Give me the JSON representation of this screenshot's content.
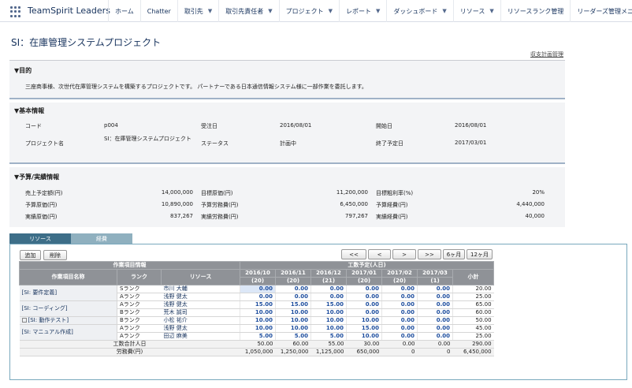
{
  "app": {
    "name": "TeamSpirit Leaders"
  },
  "nav": [
    {
      "label": "ホーム",
      "chevron": false
    },
    {
      "label": "Chatter",
      "chevron": false
    },
    {
      "label": "取引先",
      "chevron": true
    },
    {
      "label": "取引先責任者",
      "chevron": true
    },
    {
      "label": "プロジェクト",
      "chevron": true
    },
    {
      "label": "レポート",
      "chevron": true
    },
    {
      "label": "ダッシュボード",
      "chevron": true
    },
    {
      "label": "リソース",
      "chevron": true
    },
    {
      "label": "リソースランク管理",
      "chevron": false
    },
    {
      "label": "リーダーズ管理メニュー",
      "chevron": false
    }
  ],
  "page": {
    "title": "SI：在庫管理システムプロジェクト",
    "top_link": "収支計画管理"
  },
  "purpose": {
    "header": "▼目的",
    "text": "三座商事様、次世代在庫管理システムを構築するプロジェクトです。 パートナーである日本通信情報システム様に一部作業を委託します。"
  },
  "basic": {
    "header": "▼基本情報",
    "code_label": "コード",
    "code_value": "p004",
    "order_label": "受注日",
    "order_value": "2016/08/01",
    "start_label": "開始日",
    "start_value": "2016/08/01",
    "name_label": "プロジェクト名",
    "name_value": "SI：在庫管理システムプロジェクト",
    "status_label": "ステータス",
    "status_value": "計画中",
    "end_label": "終了予定日",
    "end_value": "2017/03/01"
  },
  "budget": {
    "header": "▼予算/実績情報",
    "sales_label": "売上予定額(円)",
    "sales_value": "14,000,000",
    "target_cost_label": "目標原価(円)",
    "target_cost_value": "11,200,000",
    "target_margin_label": "目標粗利率(%)",
    "target_margin_value": "20%",
    "budget_cost_label": "予算原価(円)",
    "budget_cost_value": "10,890,000",
    "budget_labor_label": "予算労務費(円)",
    "budget_labor_value": "6,450,000",
    "budget_exp_label": "予算経費(円)",
    "budget_exp_value": "4,440,000",
    "actual_cost_label": "実績原価(円)",
    "actual_cost_value": "837,267",
    "actual_labor_label": "実績労務費(円)",
    "actual_labor_value": "797,267",
    "actual_exp_label": "実績経費(円)",
    "actual_exp_value": "40,000"
  },
  "tabs": {
    "resource": "リソース",
    "expense": "経費"
  },
  "toolbar": {
    "add": "追加",
    "delete": "削除",
    "first": "<<",
    "prev": "<",
    "next": ">",
    "last": ">>",
    "six": "6ヶ月",
    "twelve": "12ヶ月"
  },
  "table": {
    "group_header": "作業項目情報",
    "plan_header": "工数予定(人日)",
    "col_item": "作業項目名称",
    "col_rank": "ランク",
    "col_resource": "リソース",
    "col_subtotal": "小計",
    "months": [
      {
        "label": "2016/10",
        "days": "(20)"
      },
      {
        "label": "2016/11",
        "days": "(20)"
      },
      {
        "label": "2016/12",
        "days": "(21)"
      },
      {
        "label": "2017/01",
        "days": "(20)"
      },
      {
        "label": "2017/02",
        "days": "(20)"
      },
      {
        "label": "2017/03",
        "days": "(1)"
      }
    ],
    "groups": [
      {
        "name": "[SI: 要件定義]",
        "checkbox": false,
        "rows": [
          {
            "rank": "Sランク",
            "resource": "市川 大輔",
            "values": [
              "0.00",
              "0.00",
              "0.00",
              "0.00",
              "0.00",
              "0.00"
            ],
            "subtotal": "20.00"
          },
          {
            "rank": "Aランク",
            "resource": "浅野 健太",
            "values": [
              "0.00",
              "0.00",
              "0.00",
              "0.00",
              "0.00",
              "0.00"
            ],
            "subtotal": "25.00"
          }
        ]
      },
      {
        "name": "[SI: コーディング]",
        "checkbox": false,
        "rows": [
          {
            "rank": "Aランク",
            "resource": "浅野 健太",
            "values": [
              "15.00",
              "15.00",
              "15.00",
              "0.00",
              "0.00",
              "0.00"
            ],
            "subtotal": "65.00"
          },
          {
            "rank": "Bランク",
            "resource": "荒木 誠司",
            "values": [
              "10.00",
              "10.00",
              "10.00",
              "0.00",
              "0.00",
              "0.00"
            ],
            "subtotal": "60.00"
          }
        ]
      },
      {
        "name": "[SI: 動作テスト]",
        "checkbox": true,
        "rows": [
          {
            "rank": "Bランク",
            "resource": "小松 祐介",
            "values": [
              "10.00",
              "10.00",
              "10.00",
              "10.00",
              "0.00",
              "0.00"
            ],
            "subtotal": "50.00"
          }
        ]
      },
      {
        "name": "[SI: マニュアル作成]",
        "checkbox": false,
        "rows": [
          {
            "rank": "Aランク",
            "resource": "浅野 健太",
            "values": [
              "10.00",
              "10.00",
              "10.00",
              "15.00",
              "0.00",
              "0.00"
            ],
            "subtotal": "45.00"
          },
          {
            "rank": "Aランク",
            "resource": "田辺 麻美",
            "values": [
              "5.00",
              "5.00",
              "5.00",
              "10.00",
              "0.00",
              "0.00"
            ],
            "subtotal": "25.00"
          }
        ]
      }
    ],
    "totals": [
      {
        "label": "工数合計人日",
        "values": [
          "50.00",
          "60.00",
          "55.00",
          "30.00",
          "0.00",
          "0.00"
        ],
        "subtotal": "290.00"
      },
      {
        "label": "労務費(円)",
        "values": [
          "1,050,000",
          "1,250,000",
          "1,125,000",
          "650,000",
          "0",
          "0"
        ],
        "subtotal": "6,450,000"
      }
    ]
  }
}
